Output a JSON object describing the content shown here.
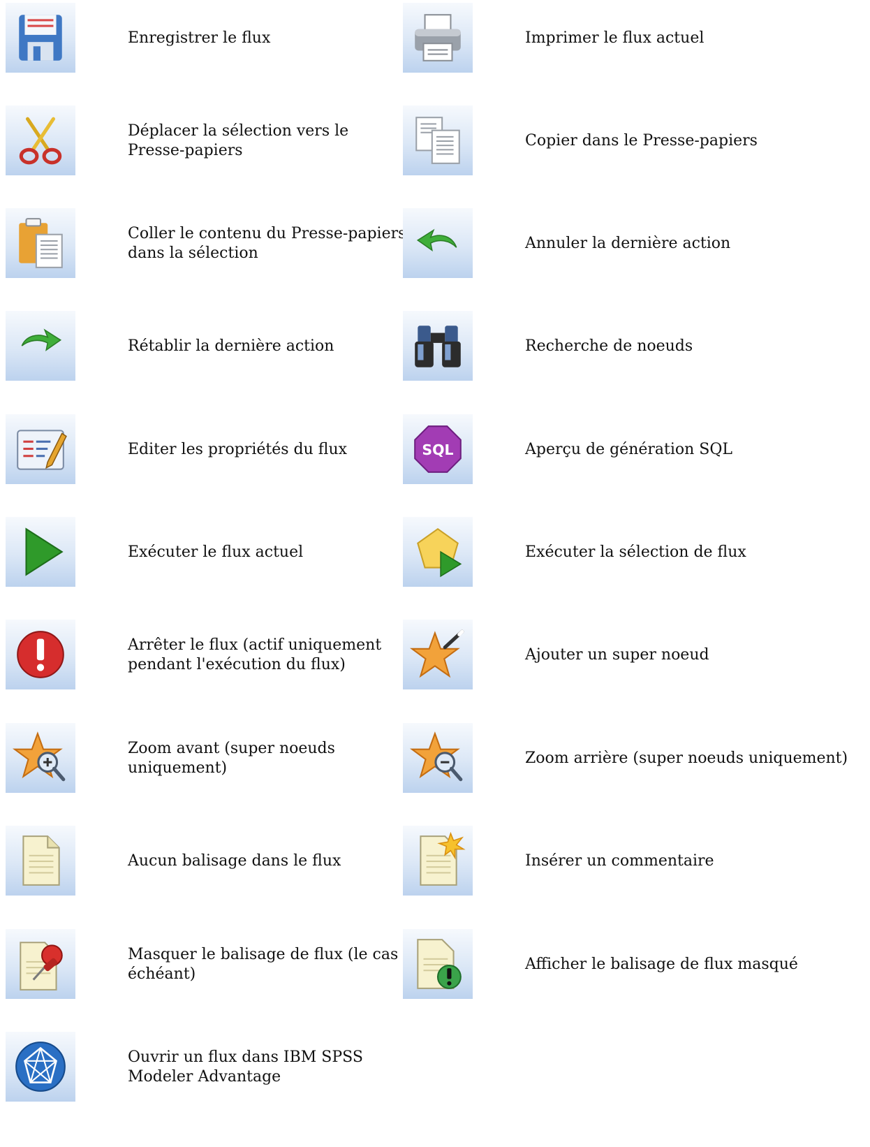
{
  "toolbar_items": [
    {
      "icon": "save-icon",
      "label": "Enregistrer le flux"
    },
    {
      "icon": "print-icon",
      "label": "Imprimer le flux actuel"
    },
    {
      "icon": "cut-icon",
      "label": "Déplacer la sélection vers le Presse-papiers"
    },
    {
      "icon": "copy-icon",
      "label": "Copier dans le Presse-papiers"
    },
    {
      "icon": "paste-icon",
      "label": "Coller le contenu du Presse-papiers dans la sélection"
    },
    {
      "icon": "undo-icon",
      "label": "Annuler la dernière action"
    },
    {
      "icon": "redo-icon",
      "label": "Rétablir la dernière action"
    },
    {
      "icon": "binoculars-icon",
      "label": "Recherche de noeuds"
    },
    {
      "icon": "edit-properties-icon",
      "label": "Editer les propriétés du flux"
    },
    {
      "icon": "sql-icon",
      "label": "Aperçu de génération SQL",
      "badge_text": "SQL"
    },
    {
      "icon": "run-icon",
      "label": "Exécuter le flux actuel"
    },
    {
      "icon": "run-selection-icon",
      "label": "Exécuter la sélection de flux"
    },
    {
      "icon": "stop-icon",
      "label": "Arrêter le flux (actif uniquement pendant l'exécution du flux)"
    },
    {
      "icon": "supernode-icon",
      "label": "Ajouter un super noeud"
    },
    {
      "icon": "zoom-in-icon",
      "label": "Zoom avant (super noeuds uniquement)"
    },
    {
      "icon": "zoom-out-icon",
      "label": "Zoom arrière (super noeuds uniquement)"
    },
    {
      "icon": "no-markup-icon",
      "label": "Aucun balisage dans le flux"
    },
    {
      "icon": "insert-comment-icon",
      "label": "Insérer un commentaire"
    },
    {
      "icon": "hide-markup-icon",
      "label": "Masquer le balisage de flux (le cas échéant)"
    },
    {
      "icon": "show-markup-icon",
      "label": "Afficher le balisage de flux masqué"
    },
    {
      "icon": "modeler-advantage-icon",
      "label": "Ouvrir un flux dans IBM SPSS Modeler Advantage"
    }
  ]
}
